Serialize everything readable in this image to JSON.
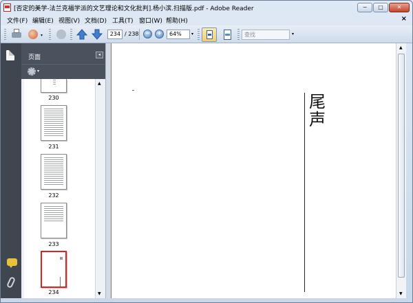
{
  "window": {
    "title": "[否定的美学-法兰克福学派的文艺理论和文化批判].杨小滨.扫描版.pdf - Adobe Reader",
    "minimize_label": "−",
    "maximize_label": "□",
    "close_label": "✕"
  },
  "menu": {
    "items": [
      "文件(F)",
      "编辑(E)",
      "视图(V)",
      "文档(D)",
      "工具(T)",
      "窗口(W)",
      "帮助(H)"
    ],
    "close_label": "×"
  },
  "toolbar": {
    "current_page": "234",
    "total_pages": "/ 238",
    "zoom_out_label": "−",
    "zoom_in_label": "+",
    "zoom_value": "64%",
    "find_placeholder": "查找",
    "dropdown_glyph": "▾"
  },
  "panel": {
    "title": "页面",
    "collapse_glyph": "◂",
    "thumbnails": [
      {
        "page": "230",
        "selected": false
      },
      {
        "page": "231",
        "selected": false
      },
      {
        "page": "232",
        "selected": false
      },
      {
        "page": "233",
        "selected": false
      },
      {
        "page": "234",
        "selected": true
      }
    ]
  },
  "document": {
    "heading": "尾声"
  },
  "icons": {
    "up": "▲",
    "down": "▼"
  }
}
